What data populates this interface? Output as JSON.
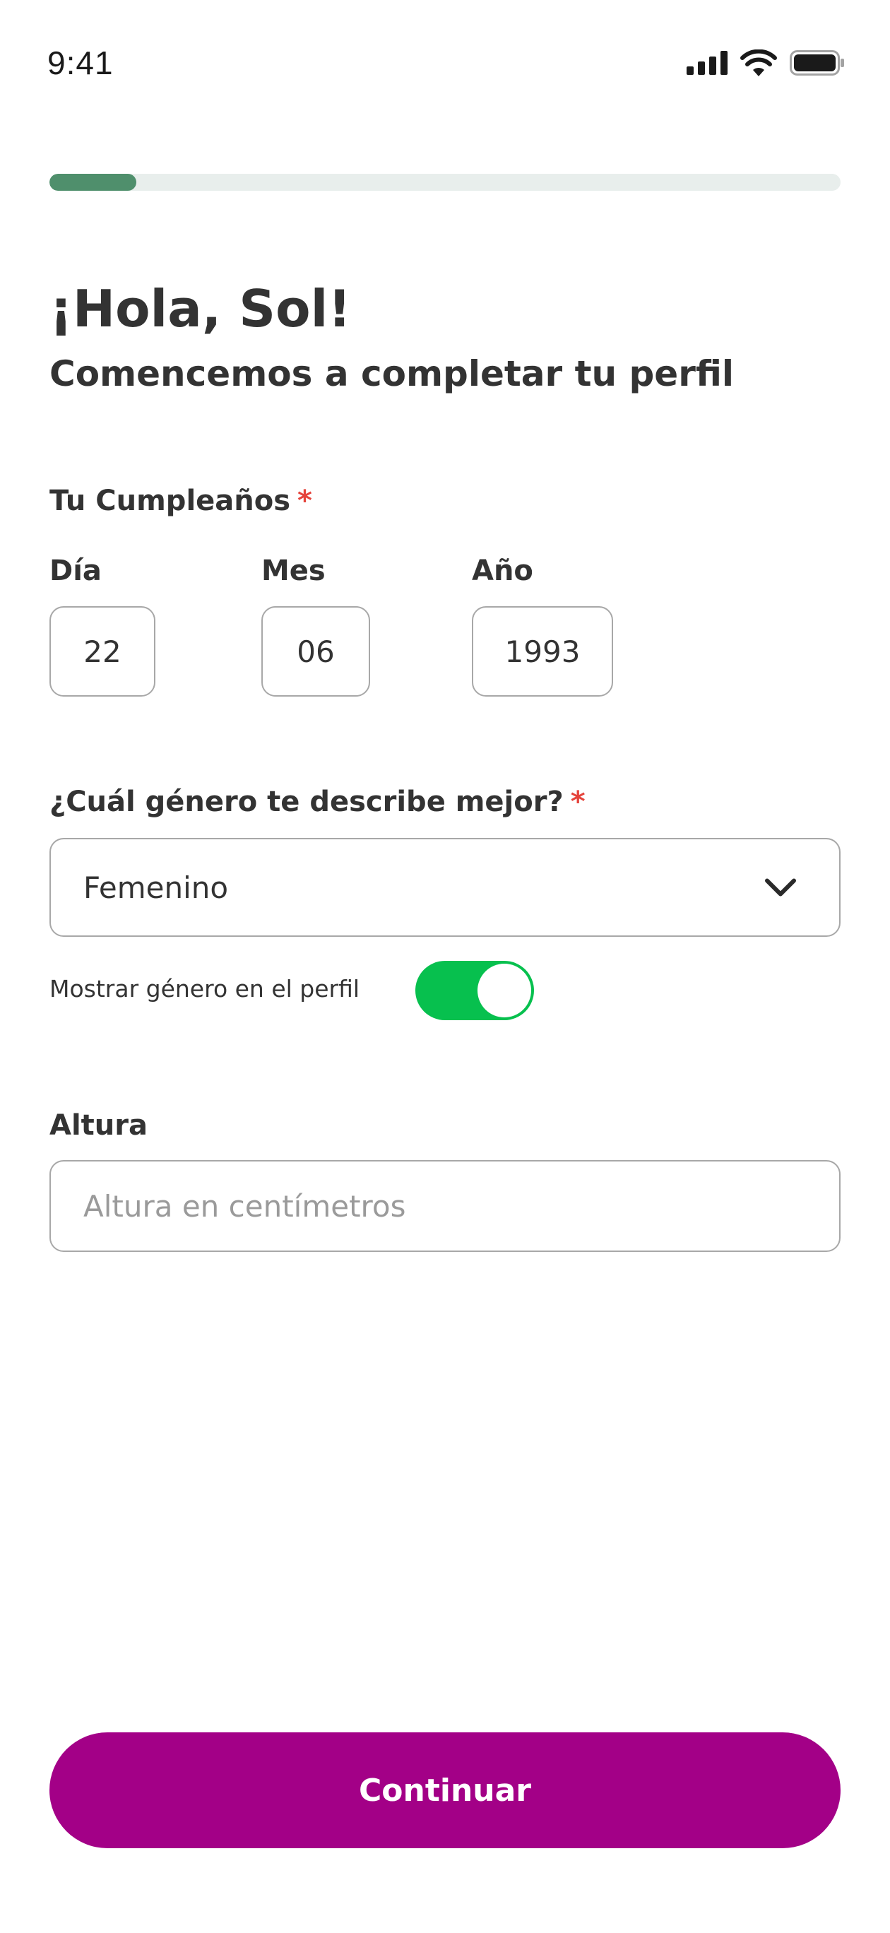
{
  "status_bar": {
    "time": "9:41",
    "icons": [
      "cellular-signal-icon",
      "wifi-icon",
      "battery-icon"
    ]
  },
  "progress": {
    "value_percent": 11,
    "fill_color": "#4f8f6c",
    "track_color": "#e8eeec"
  },
  "header": {
    "greeting": "¡Hola, Sol!",
    "subtitle": "Comencemos a completar tu perfil"
  },
  "birthday": {
    "label": "Tu Cumpleaños",
    "required_mark": "*",
    "day": {
      "label": "Día",
      "value": "22"
    },
    "month": {
      "label": "Mes",
      "value": "06"
    },
    "year": {
      "label": "Año",
      "value": "1993"
    }
  },
  "gender": {
    "label": "¿Cuál género te describe mejor?",
    "required_mark": "*",
    "selected": "Femenino",
    "dropdown_icon": "chevron-down-icon",
    "show_toggle_label": "Mostrar género en el perfil",
    "show_toggle_on": true,
    "toggle_color": "#07c04e"
  },
  "height": {
    "label": "Altura",
    "placeholder": "Altura en centímetros",
    "value": ""
  },
  "cta": {
    "label": "Continuar",
    "color": "#a30087"
  }
}
